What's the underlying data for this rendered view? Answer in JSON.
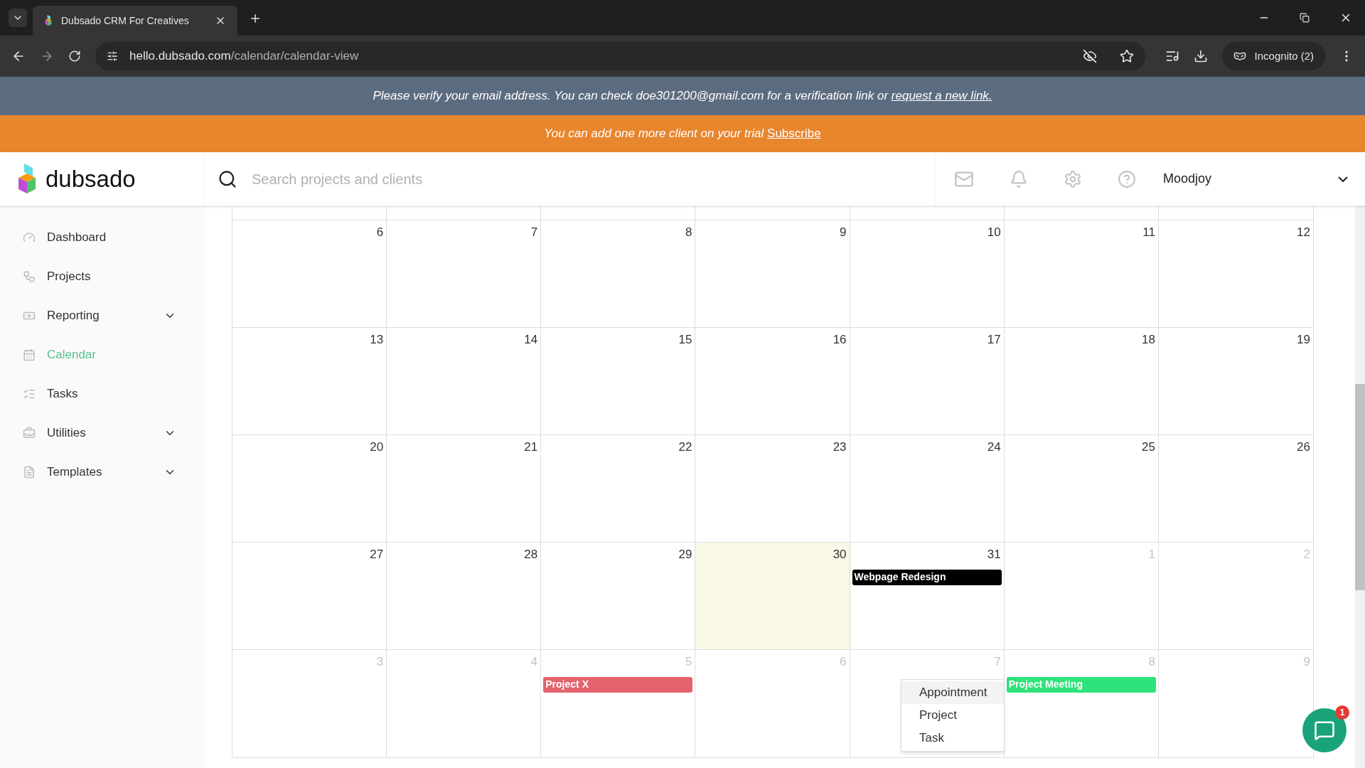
{
  "browser": {
    "tab_title": "Dubsado CRM For Creatives",
    "url_host": "hello.dubsado.com",
    "url_path": "/calendar/calendar-view",
    "profile": "Incognito (2)"
  },
  "verify_banner": {
    "text": "Please verify your email address. You can check doe301200@gmail.com for a verification link or ",
    "link": "request a new link."
  },
  "trial_banner": {
    "text": "You can add one more client on your trial ",
    "link": "Subscribe"
  },
  "header": {
    "logo": "dubsado",
    "search_placeholder": "Search projects and clients",
    "user": "Moodjoy"
  },
  "sidebar": {
    "items": [
      {
        "label": "Dashboard",
        "selected": false,
        "expandable": false
      },
      {
        "label": "Projects",
        "selected": false,
        "expandable": false
      },
      {
        "label": "Reporting",
        "selected": false,
        "expandable": true
      },
      {
        "label": "Calendar",
        "selected": true,
        "expandable": false
      },
      {
        "label": "Tasks",
        "selected": false,
        "expandable": false
      },
      {
        "label": "Utilities",
        "selected": false,
        "expandable": true
      },
      {
        "label": "Templates",
        "selected": false,
        "expandable": true
      }
    ]
  },
  "calendar": {
    "weeks": [
      {
        "days": [
          {
            "label": "6",
            "muted": false,
            "today": false
          },
          {
            "label": "7",
            "muted": false,
            "today": false
          },
          {
            "label": "8",
            "muted": false,
            "today": false
          },
          {
            "label": "9",
            "muted": false,
            "today": false
          },
          {
            "label": "10",
            "muted": false,
            "today": false
          },
          {
            "label": "11",
            "muted": false,
            "today": false
          },
          {
            "label": "12",
            "muted": false,
            "today": false
          }
        ]
      },
      {
        "days": [
          {
            "label": "13",
            "muted": false,
            "today": false
          },
          {
            "label": "14",
            "muted": false,
            "today": false
          },
          {
            "label": "15",
            "muted": false,
            "today": false
          },
          {
            "label": "16",
            "muted": false,
            "today": false
          },
          {
            "label": "17",
            "muted": false,
            "today": false
          },
          {
            "label": "18",
            "muted": false,
            "today": false
          },
          {
            "label": "19",
            "muted": false,
            "today": false
          }
        ]
      },
      {
        "days": [
          {
            "label": "20",
            "muted": false,
            "today": false
          },
          {
            "label": "21",
            "muted": false,
            "today": false
          },
          {
            "label": "22",
            "muted": false,
            "today": false
          },
          {
            "label": "23",
            "muted": false,
            "today": false
          },
          {
            "label": "24",
            "muted": false,
            "today": false
          },
          {
            "label": "25",
            "muted": false,
            "today": false
          },
          {
            "label": "26",
            "muted": false,
            "today": false
          }
        ]
      },
      {
        "days": [
          {
            "label": "27",
            "muted": false,
            "today": false
          },
          {
            "label": "28",
            "muted": false,
            "today": false
          },
          {
            "label": "29",
            "muted": false,
            "today": false
          },
          {
            "label": "30",
            "muted": false,
            "today": true
          },
          {
            "label": "31",
            "muted": false,
            "today": false,
            "events": [
              {
                "title": "Webpage Redesign",
                "color": "#000000"
              }
            ]
          },
          {
            "label": "1",
            "muted": true,
            "today": false
          },
          {
            "label": "2",
            "muted": true,
            "today": false
          }
        ]
      },
      {
        "days": [
          {
            "label": "3",
            "muted": true,
            "today": false
          },
          {
            "label": "4",
            "muted": true,
            "today": false
          },
          {
            "label": "5",
            "muted": true,
            "today": false,
            "events": [
              {
                "title": "Project X",
                "color": "#e5636e"
              }
            ]
          },
          {
            "label": "6",
            "muted": true,
            "today": false
          },
          {
            "label": "7",
            "muted": true,
            "today": false
          },
          {
            "label": "8",
            "muted": true,
            "today": false,
            "events": [
              {
                "title": "Project Meeting",
                "color": "#2ee27a"
              }
            ]
          },
          {
            "label": "9",
            "muted": true,
            "today": false
          }
        ]
      }
    ]
  },
  "add_menu": {
    "items": [
      {
        "label": "Appointment",
        "selected": true
      },
      {
        "label": "Project",
        "selected": false
      },
      {
        "label": "Task",
        "selected": false
      }
    ]
  },
  "chat": {
    "badge": "1"
  }
}
